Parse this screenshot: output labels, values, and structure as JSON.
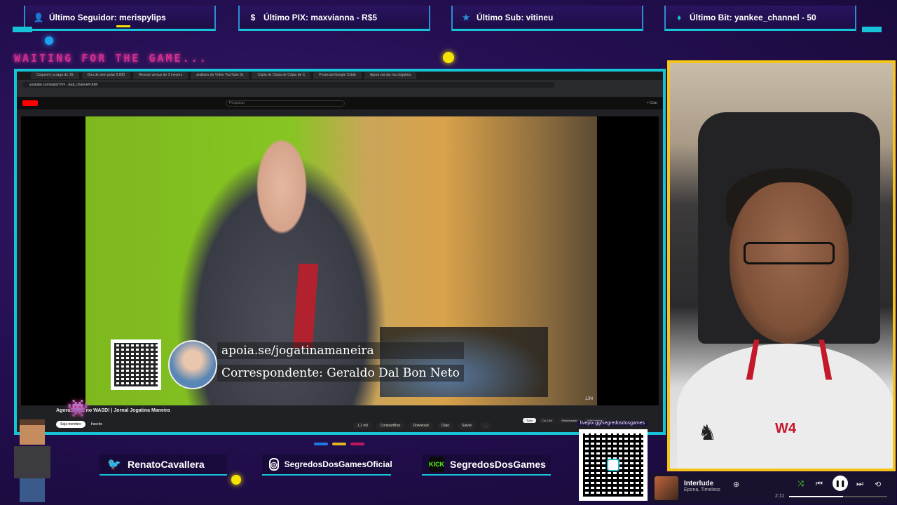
{
  "alerts": {
    "follower": "Último Seguidor: merispylips",
    "pix": "Último PIX: maxvianna - R$5",
    "sub": "Último Sub: vitineu",
    "bit": "Último Bit: yankee_channel - 50"
  },
  "waiting_text": "WAITING FOR THE GAME...",
  "browser": {
    "tabs": [
      "Coquem | a saga do JG",
      "Dou de sem pular 5.000",
      "Rescue versus de 3 meyers",
      "análises do Vídeo YouTube 3x",
      "Cópia de Cópia de Cópia de C",
      "Prosocial Google Colab",
      "Agora vai dar ma Jogatina"
    ],
    "url": "youtube.com/watch?v=...&ab_channel=JoM",
    "search_placeholder": "Pesquisar",
    "create_label": "+ Criar"
  },
  "lower_third": {
    "line1": "apoia.se/jogatinamaneira",
    "line2": "Correspondente: Geraldo Dal Bon Neto"
  },
  "watermark": "JJM",
  "video_title": "Agora... LoL no WASD! | Jornal Jogatina Maneira",
  "channel": {
    "subscribe": "Seja membro",
    "subscribed": "Inscrito"
  },
  "actions": [
    "1,1 mil",
    "Compartilhar",
    "Download",
    "Clipe",
    "Salvar",
    "..."
  ],
  "chips": [
    "Tudo",
    "Do JJM",
    "Relacionado",
    "Adicionados"
  ],
  "social": {
    "twitter": "RenatoCavallera",
    "instagram": "SegredosDosGamesOficial",
    "kick_badge": "KICK",
    "kick": "SegredosDosGames"
  },
  "livepix": "livepix.gg/segredosdosgames",
  "music": {
    "title": "Interlude",
    "artist": "Epona, Timeless",
    "time": "2:11",
    "progress": 0.55
  },
  "colors": {
    "frame_cyan": "#17c3d6",
    "webcam_yellow": "#f5c518",
    "accent_pink": "#d32e8c"
  }
}
